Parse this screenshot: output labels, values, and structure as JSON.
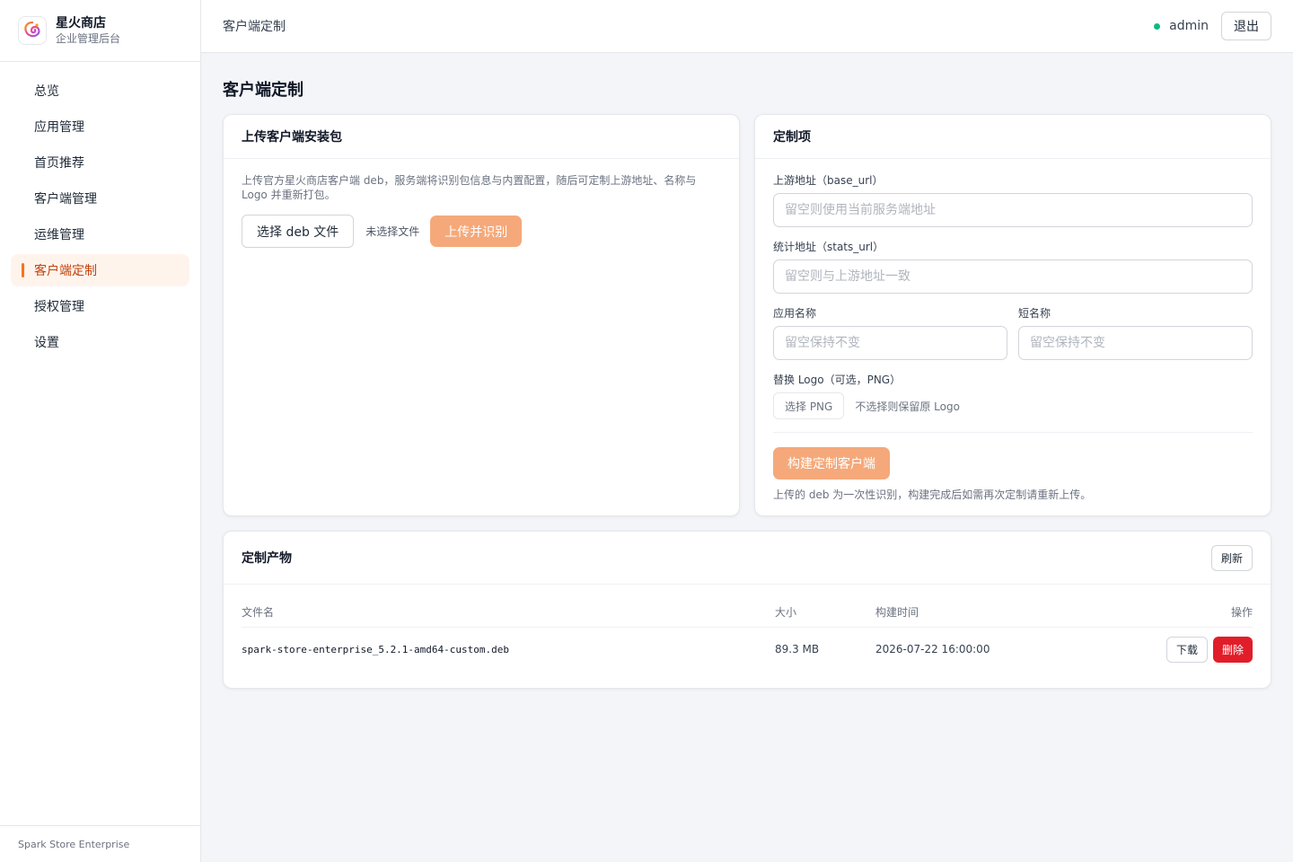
{
  "brand": {
    "title": "星火商店",
    "subtitle": "企业管理后台",
    "logo_icon": "spark-logo-icon"
  },
  "sidebar": {
    "items": [
      {
        "label": "总览",
        "active": false
      },
      {
        "label": "应用管理",
        "active": false
      },
      {
        "label": "首页推荐",
        "active": false
      },
      {
        "label": "客户端管理",
        "active": false
      },
      {
        "label": "运维管理",
        "active": false
      },
      {
        "label": "客户端定制",
        "active": true
      },
      {
        "label": "授权管理",
        "active": false
      },
      {
        "label": "设置",
        "active": false
      }
    ],
    "footer": "Spark Store Enterprise"
  },
  "header": {
    "breadcrumb": "客户端定制",
    "user": "admin",
    "logout_label": "退出",
    "status_color": "#10b981"
  },
  "page": {
    "title": "客户端定制"
  },
  "upload_card": {
    "title": "上传客户端安装包",
    "description": "上传官方星火商店客户端 deb，服务端将识别包信息与内置配置，随后可定制上游地址、名称与 Logo 并重新打包。",
    "choose_label": "选择 deb 文件",
    "no_file": "未选择文件",
    "upload_label": "上传并识别"
  },
  "custom_card": {
    "title": "定制项",
    "base_url_label": "上游地址（base_url）",
    "base_url_placeholder": "留空则使用当前服务端地址",
    "stats_url_label": "统计地址（stats_url）",
    "stats_url_placeholder": "留空则与上游地址一致",
    "app_name_label": "应用名称",
    "app_name_placeholder": "留空保持不变",
    "short_name_label": "短名称",
    "short_name_placeholder": "留空保持不变",
    "logo_label": "替换 Logo（可选，PNG）",
    "choose_png_label": "选择 PNG",
    "logo_hint": "不选择则保留原 Logo",
    "build_label": "构建定制客户端",
    "note": "上传的 deb 为一次性识别，构建完成后如需再次定制请重新上传。"
  },
  "artifacts": {
    "title": "定制产物",
    "refresh_label": "刷新",
    "columns": {
      "name": "文件名",
      "size": "大小",
      "time": "构建时间",
      "action": "操作"
    },
    "rows": [
      {
        "name": "spark-store-enterprise_5.2.1-amd64-custom.deb",
        "size": "89.3 MB",
        "time": "2026-07-22 16:00:00",
        "download": "下载",
        "delete": "删除"
      }
    ]
  },
  "colors": {
    "accent": "#f97316",
    "primary_button": "#f5a97a",
    "danger": "#e11d2a"
  }
}
